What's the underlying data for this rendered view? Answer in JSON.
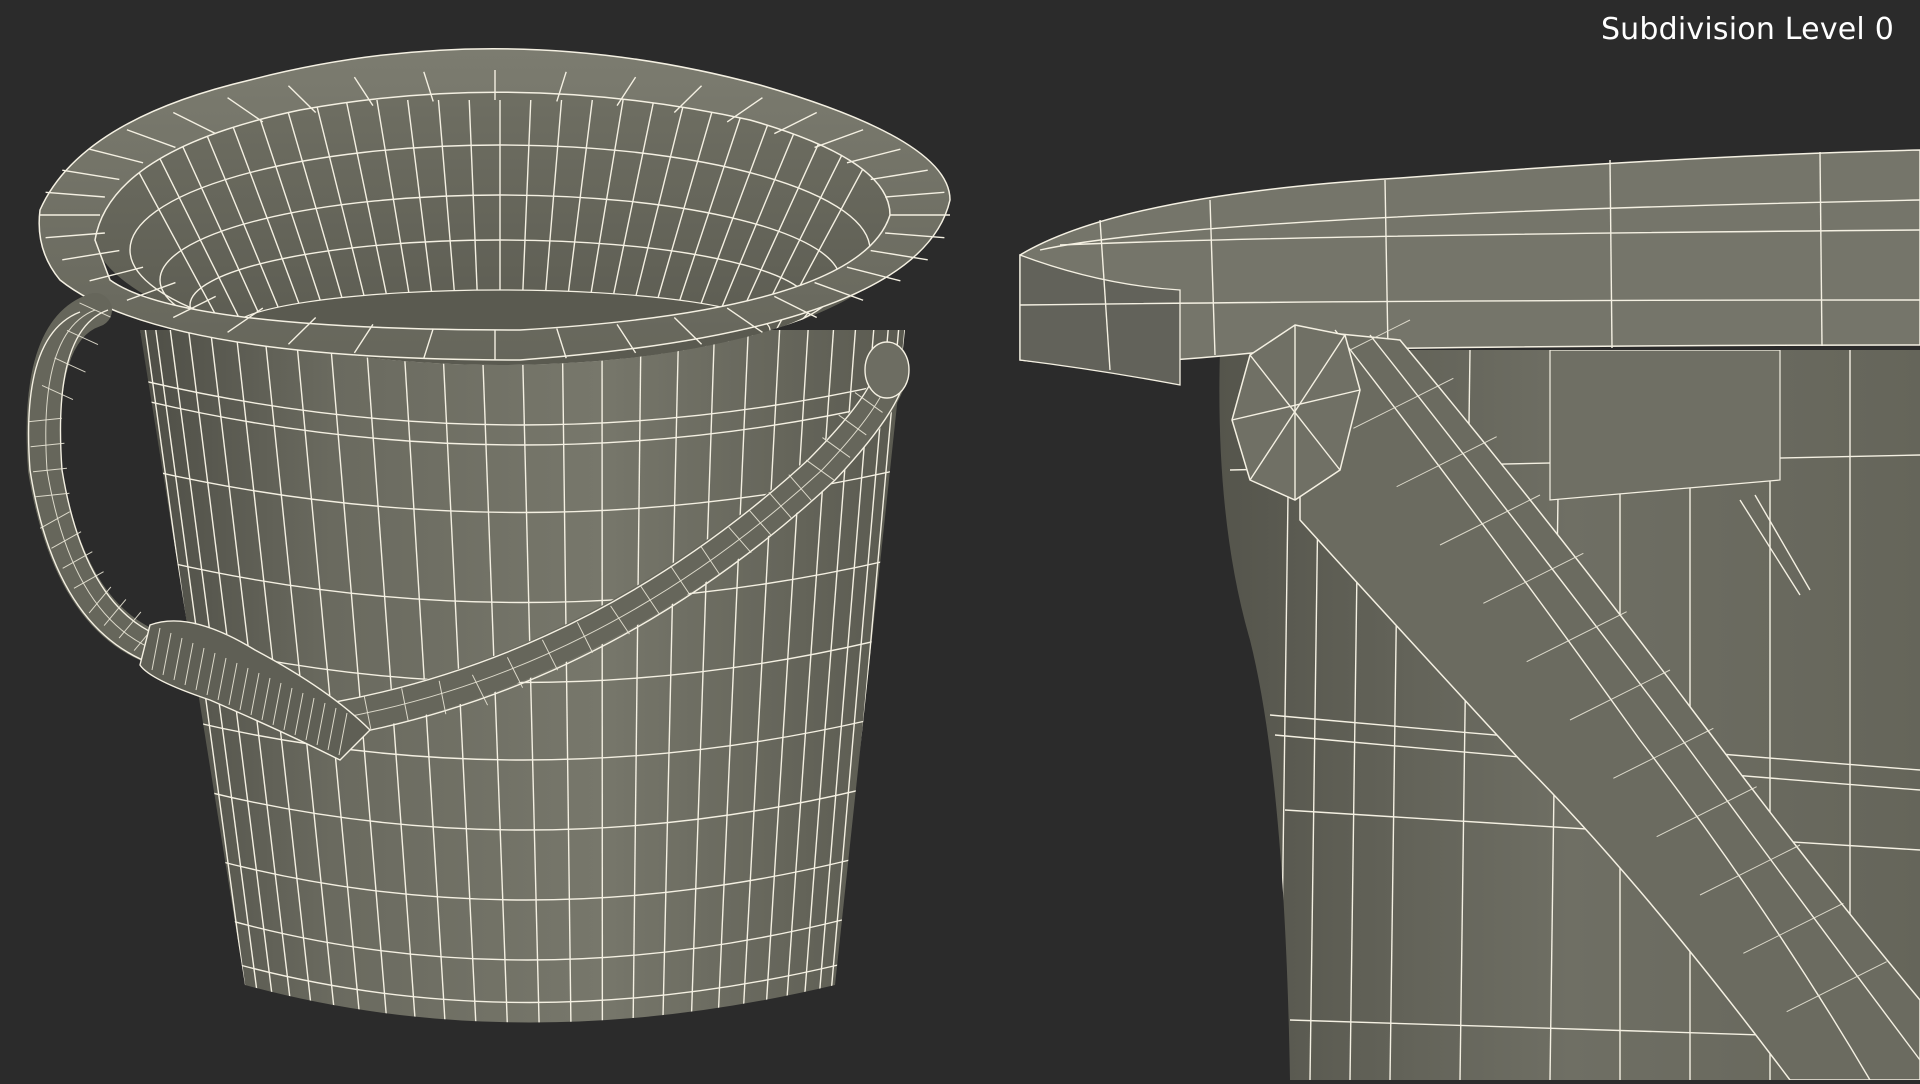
{
  "overlay": {
    "label": "Subdivision Level 0"
  },
  "colors": {
    "background": "#2b2b2b",
    "model_shading": "#6e6e62",
    "wireframe": "#f4f0e2"
  },
  "scene": {
    "views": [
      "bucket-full-view",
      "bucket-handle-closeup-view"
    ]
  }
}
